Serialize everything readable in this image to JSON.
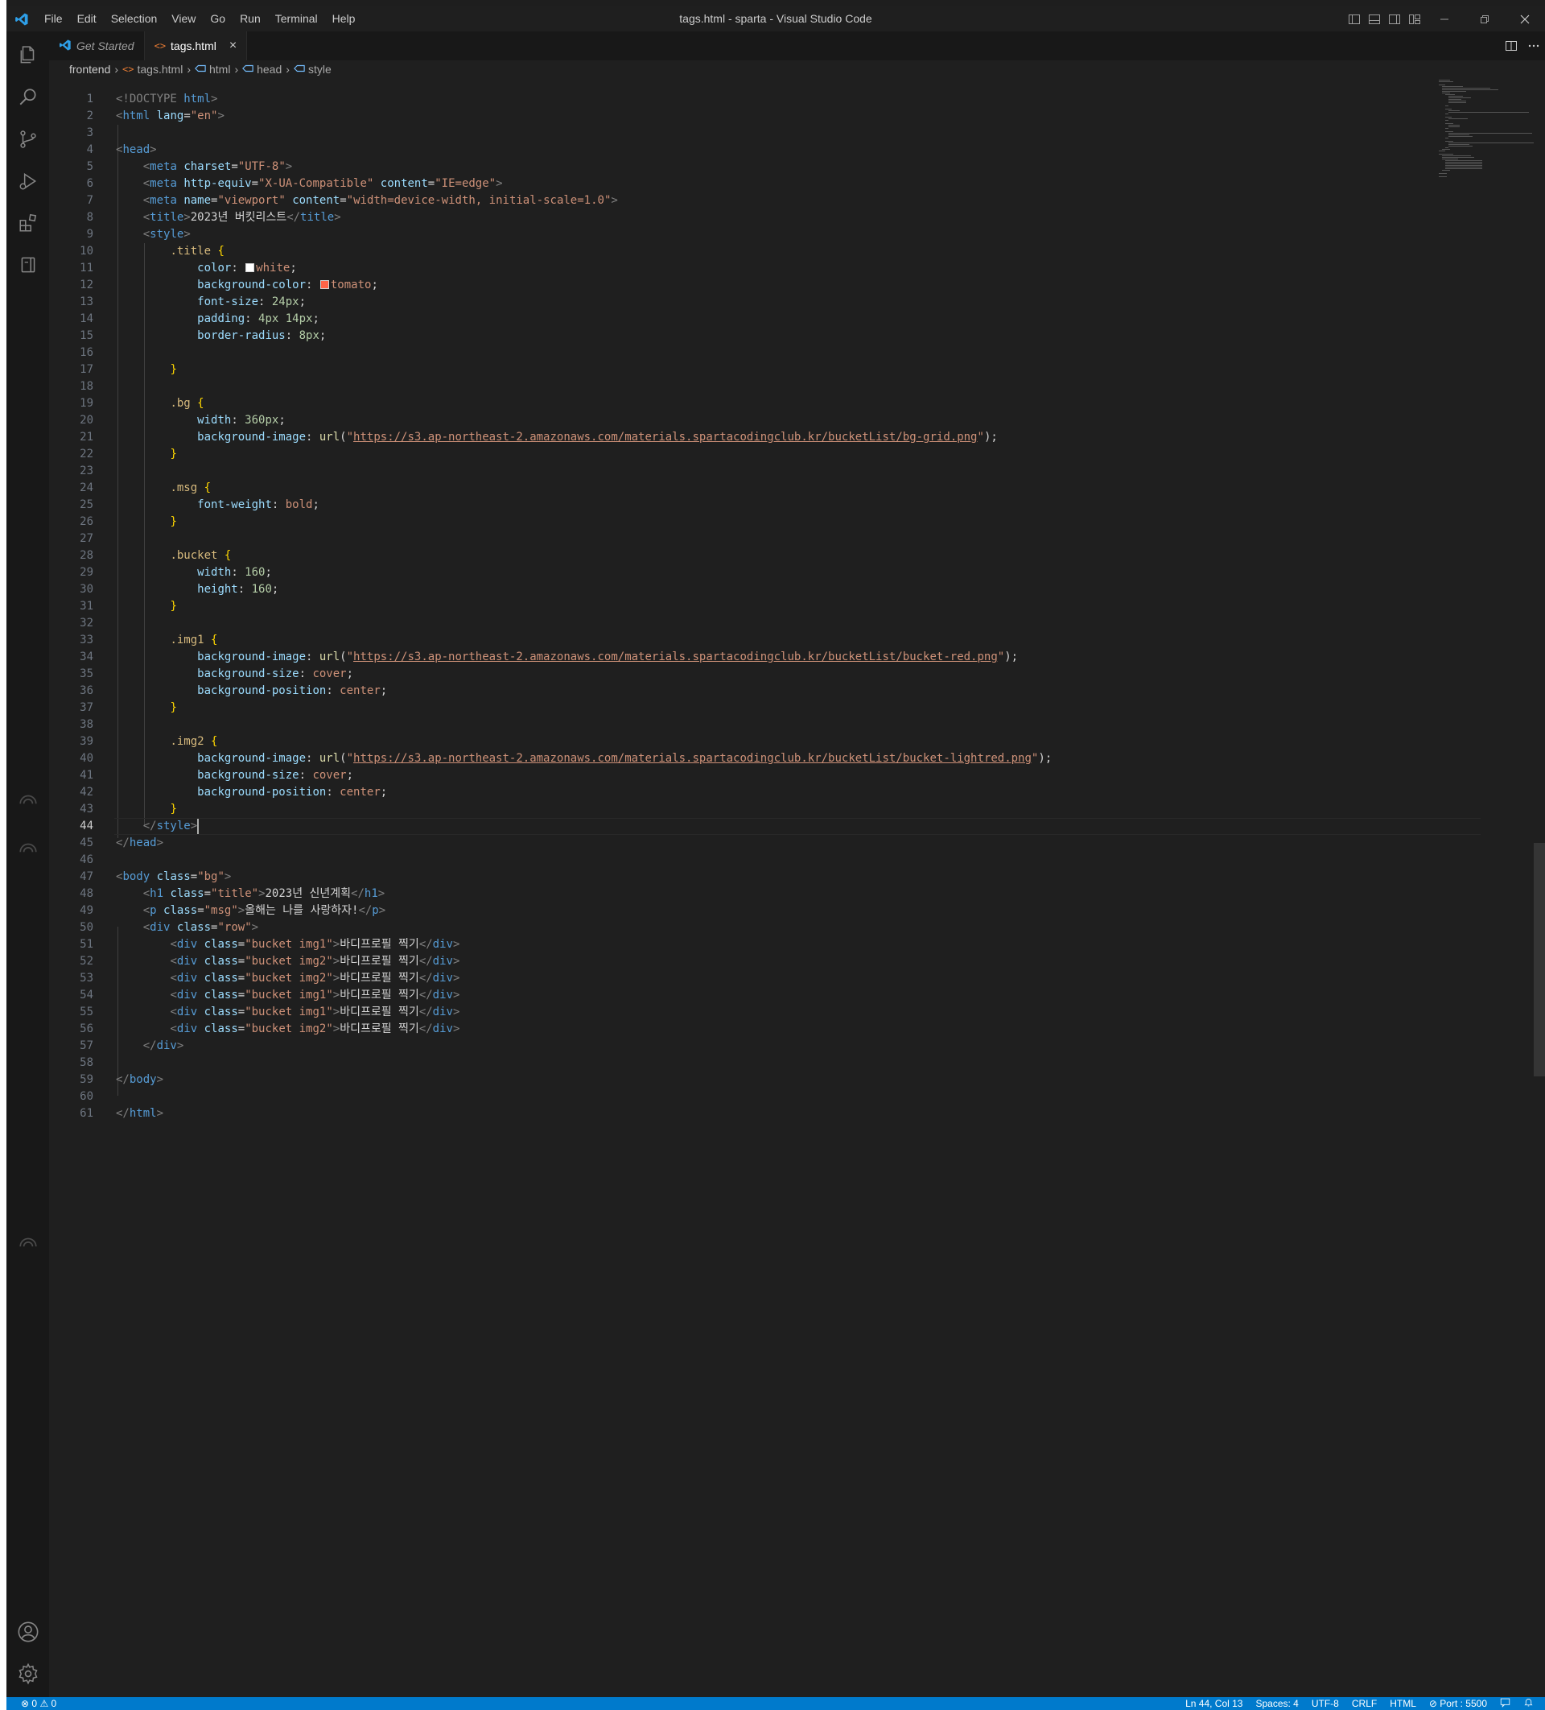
{
  "window": {
    "title": "tags.html - sparta - Visual Studio Code"
  },
  "menu": [
    "File",
    "Edit",
    "Selection",
    "View",
    "Go",
    "Run",
    "Terminal",
    "Help"
  ],
  "tabs": [
    {
      "label": "Get Started",
      "icon": "vscode-logo-icon",
      "active": false
    },
    {
      "label": "tags.html",
      "icon": "html-file-icon",
      "active": true,
      "close": "×"
    }
  ],
  "breadcrumbs": {
    "folder": "frontend",
    "file": "tags.html",
    "symbols": [
      "html",
      "head",
      "style"
    ]
  },
  "editor": {
    "current_line": 44,
    "lines": [
      "1",
      "2",
      "3",
      "4",
      "5",
      "6",
      "7",
      "8",
      "9",
      "10",
      "11",
      "12",
      "13",
      "14",
      "15",
      "16",
      "17",
      "18",
      "19",
      "20",
      "21",
      "22",
      "23",
      "24",
      "25",
      "26",
      "27",
      "28",
      "29",
      "30",
      "31",
      "32",
      "33",
      "34",
      "35",
      "36",
      "37",
      "38",
      "39",
      "40",
      "41",
      "42",
      "43",
      "44",
      "45",
      "46",
      "47",
      "48",
      "49",
      "50",
      "51",
      "52",
      "53",
      "54",
      "55",
      "56",
      "57",
      "58",
      "59",
      "60",
      "61"
    ],
    "code": {
      "l1a": "<!DOCTYPE",
      "l1b": " html",
      "l1c": ">",
      "lang": "\"en\"",
      "charset": "\"UTF-8\"",
      "http_equiv": "\"X-UA-Compatible\"",
      "ie_edge": "\"IE=edge\"",
      "viewport": "\"viewport\"",
      "viewport_content": "\"width=device-width, initial-scale=1.0\"",
      "page_title": "2023년 버킷리스트",
      "sel_title": ".title",
      "sel_bg": ".bg",
      "sel_msg": ".msg",
      "sel_bucket": ".bucket",
      "sel_img1": ".img1",
      "sel_img2": ".img2",
      "color_val": "white",
      "bgcolor_val": "tomato",
      "font_size_val": "24px",
      "padding_val": "4px 14px",
      "radius_val": "8px",
      "width_360": "360px",
      "url_grid": "https://s3.ap-northeast-2.amazonaws.com/materials.spartacodingclub.kr/bucketList/bg-grid.png",
      "fw_val": "bold",
      "w160": "160",
      "h160": "160",
      "url_red": "https://s3.ap-northeast-2.amazonaws.com/materials.spartacodingclub.kr/bucketList/bucket-red.png",
      "url_lightred": "https://s3.ap-northeast-2.amazonaws.com/materials.spartacodingclub.kr/bucketList/bucket-lightred.png",
      "cover": "cover",
      "center": "center",
      "body_class": "\"bg\"",
      "h1_class": "\"title\"",
      "h1_text": "2023년 신년계획",
      "p_class": "\"msg\"",
      "p_text": "올해는 나를 사랑하자!",
      "row_class": "\"row\"",
      "cls_img1": "\"bucket img1\"",
      "cls_img2": "\"bucket img2\"",
      "div_text": "바디프로필 찍기"
    },
    "swatch_colors": {
      "white": "#ffffff",
      "tomato": "#ff6347"
    }
  },
  "statusbar": {
    "problems": "0",
    "warnings": "0",
    "position": "Ln 44, Col 13",
    "spaces": "Spaces: 4",
    "encoding": "UTF-8",
    "eol": "CRLF",
    "language": "HTML",
    "port": "Port : 5500"
  },
  "colors": {
    "accent": "#007acc",
    "background": "#1f1f1f"
  }
}
